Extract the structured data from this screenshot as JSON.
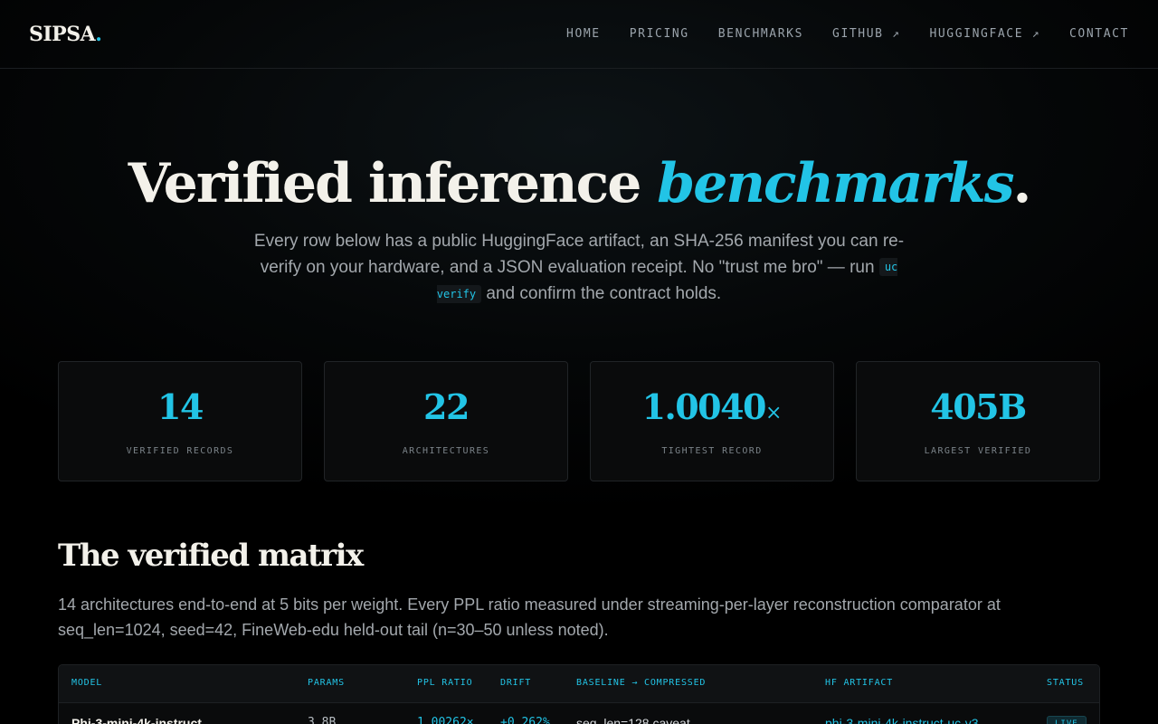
{
  "header": {
    "logo": "SIPSA",
    "logo_dot": ".",
    "nav": [
      {
        "label": "HOME"
      },
      {
        "label": "PRICING"
      },
      {
        "label": "BENCHMARKS"
      },
      {
        "label": "GITHUB ↗"
      },
      {
        "label": "HUGGINGFACE ↗"
      },
      {
        "label": "CONTACT"
      }
    ]
  },
  "hero": {
    "title_main": "Verified inference ",
    "title_accent": "benchmarks",
    "title_end": ".",
    "subtitle_before": "Every row below has a public HuggingFace artifact, an SHA-256 manifest you can re-verify on your hardware, and a JSON evaluation receipt. No \"trust me bro\" — run ",
    "subtitle_code": "uc verify",
    "subtitle_after": " and confirm the contract holds."
  },
  "stats": [
    {
      "value": "14",
      "unit": "",
      "label": "VERIFIED RECORDS"
    },
    {
      "value": "22",
      "unit": "",
      "label": "ARCHITECTURES"
    },
    {
      "value": "1.0040",
      "unit": "×",
      "label": "TIGHTEST RECORD"
    },
    {
      "value": "405B",
      "unit": "",
      "label": "LARGEST VERIFIED"
    }
  ],
  "matrix": {
    "title": "The verified matrix",
    "description": "14 architectures end-to-end at 5 bits per weight. Every PPL ratio measured under streaming-per-layer reconstruction comparator at seq_len=1024, seed=42, FineWeb-edu held-out tail (n=30–50 unless noted).",
    "columns": [
      "MODEL",
      "PARAMS",
      "PPL RATIO",
      "DRIFT",
      "BASELINE → COMPRESSED",
      "HF ARTIFACT",
      "STATUS"
    ],
    "rows": [
      {
        "model": "Phi-3-mini-4k-instruct",
        "params": "3.8B",
        "ppl_ratio": "1.00262×",
        "drift": "+0.262%",
        "baseline": "seq_len=128 caveat",
        "artifact": "phi-3-mini-4k-instruct-uc-v3",
        "status": "LIVE"
      }
    ]
  },
  "colors": {
    "accent": "#22c4e6",
    "background": "#000000",
    "text": "#f3f1ea",
    "muted": "#a3a8ad"
  }
}
